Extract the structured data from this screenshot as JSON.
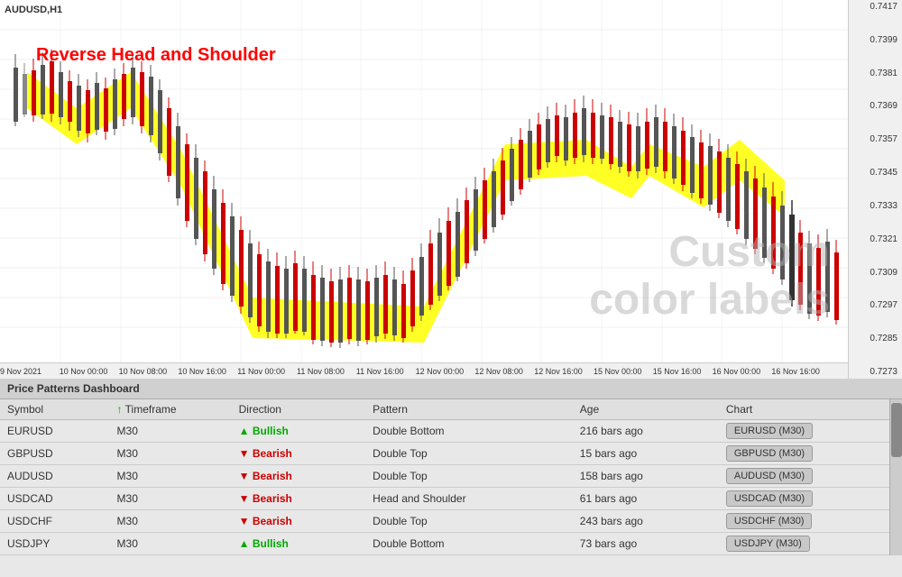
{
  "chart": {
    "symbol": "AUDUSD,H1",
    "patternLabel": "Reverse Head and Shoulder",
    "customLabel": "Custom\ncolor labels",
    "priceLabels": [
      "0.7417",
      "0.7399",
      "0.7381",
      "0.7369",
      "0.7357",
      "0.7345",
      "0.7333",
      "0.7321",
      "0.7309",
      "0.7297",
      "0.7285",
      "0.7273"
    ],
    "timeLabels": [
      {
        "text": "9 Nov 2021",
        "pos": "1%"
      },
      {
        "text": "10 Nov 00:00",
        "pos": "5%"
      },
      {
        "text": "10 Nov 08:00",
        "pos": "12%"
      },
      {
        "text": "10 Nov 16:00",
        "pos": "19%"
      },
      {
        "text": "11 Nov 00:00",
        "pos": "26%"
      },
      {
        "text": "11 Nov 08:00",
        "pos": "33%"
      },
      {
        "text": "11 Nov 16:00",
        "pos": "40%"
      },
      {
        "text": "12 Nov 00:00",
        "pos": "47%"
      },
      {
        "text": "12 Nov 08:00",
        "pos": "54%"
      },
      {
        "text": "12 Nov 16:00",
        "pos": "61%"
      },
      {
        "text": "15 Nov 00:00",
        "pos": "68%"
      },
      {
        "text": "15 Nov 16:00",
        "pos": "75%"
      },
      {
        "text": "16 Nov 00:00",
        "pos": "82%"
      },
      {
        "text": "16 Nov 16:00",
        "pos": "89%"
      }
    ]
  },
  "dashboard": {
    "title": "Price Patterns Dashboard",
    "columns": {
      "symbol": "Symbol",
      "timeframe": "Timeframe",
      "direction": "Direction",
      "pattern": "Pattern",
      "age": "Age",
      "chart": "Chart"
    },
    "rows": [
      {
        "symbol": "EURUSD",
        "timeframe": "M30",
        "direction": "Bullish",
        "directionType": "bullish",
        "pattern": "Double Bottom",
        "age": "216 bars ago",
        "chartBtn": "EURUSD (M30)"
      },
      {
        "symbol": "GBPUSD",
        "timeframe": "M30",
        "direction": "Bearish",
        "directionType": "bearish",
        "pattern": "Double Top",
        "age": "15 bars ago",
        "chartBtn": "GBPUSD (M30)"
      },
      {
        "symbol": "AUDUSD",
        "timeframe": "M30",
        "direction": "Bearish",
        "directionType": "bearish",
        "pattern": "Double Top",
        "age": "158 bars ago",
        "chartBtn": "AUDUSD (M30)"
      },
      {
        "symbol": "USDCAD",
        "timeframe": "M30",
        "direction": "Bearish",
        "directionType": "bearish",
        "pattern": "Head and Shoulder",
        "age": "61 bars ago",
        "chartBtn": "USDCAD (M30)"
      },
      {
        "symbol": "USDCHF",
        "timeframe": "M30",
        "direction": "Bearish",
        "directionType": "bearish",
        "pattern": "Double Top",
        "age": "243 bars ago",
        "chartBtn": "USDCHF (M30)"
      },
      {
        "symbol": "USDJPY",
        "timeframe": "M30",
        "direction": "Bullish",
        "directionType": "bullish",
        "pattern": "Double Bottom",
        "age": "73 bars ago",
        "chartBtn": "USDJPY (M30)"
      }
    ]
  }
}
